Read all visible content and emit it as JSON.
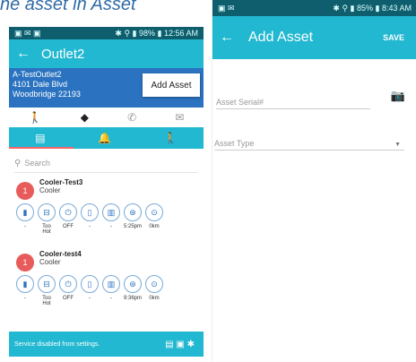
{
  "caption": "ne asset in Asset",
  "left": {
    "status_bar": {
      "left": "▣ ✉ ▣",
      "right": "✱ ⚲ ▮ 98% ▮ 12:56 AM"
    },
    "appbar_title": "Outlet2",
    "outlet": {
      "name": "A-TestOutlet2",
      "address1": "4101 Dale Blvd",
      "address2": "Woodbridge 22193"
    },
    "add_asset_label": "Add Asset",
    "search_placeholder": "Search",
    "coolers": [
      {
        "badge": "1",
        "name": "Cooler-Test3",
        "type": "Cooler",
        "values": [
          "-",
          "Too Hot",
          "OFF",
          "-",
          "-",
          "5:25pm",
          "0km"
        ]
      },
      {
        "badge": "1",
        "name": "Cooler-test4",
        "type": "Cooler",
        "values": [
          "-",
          "Too Hot",
          "OFF",
          "-",
          "-",
          "9:36pm",
          "0km"
        ]
      }
    ],
    "footer_text": "Service disabled from settings."
  },
  "right": {
    "status_bar": {
      "left": "▣ ✉",
      "right": "✱ ⚲ ▮ 85% ▮ 8:43 AM"
    },
    "appbar_title": "Add Asset",
    "save_label": "SAVE",
    "serial_placeholder": "Asset Serial#",
    "type_placeholder": "Asset Type"
  }
}
